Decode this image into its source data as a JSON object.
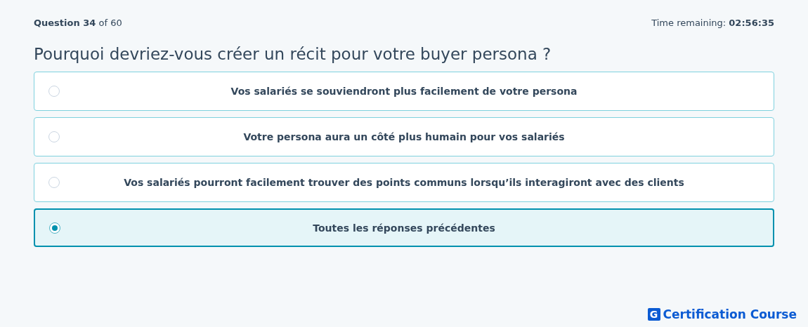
{
  "progress": "**Question 34** of 60",
  "timer": "Time remaining: **02:56:35**",
  "question": "Pourquoi devriez-vous créer un récit pour votre buyer persona ?",
  "options": [
    {
      "label": "Vos salariés se souviendront plus facilement de votre persona",
      "selected": false
    },
    {
      "label": "Votre persona aura un côté plus humain pour vos salariés",
      "selected": false
    },
    {
      "label": "Vos salariés pourront facilement trouver des points communs lorsqu’ils interagiront avec des clients",
      "selected": false
    },
    {
      "label": "Toutes les réponses précédentes",
      "selected": true
    }
  ],
  "logo": {
    "mark": "G",
    "text": "Certification Course"
  }
}
